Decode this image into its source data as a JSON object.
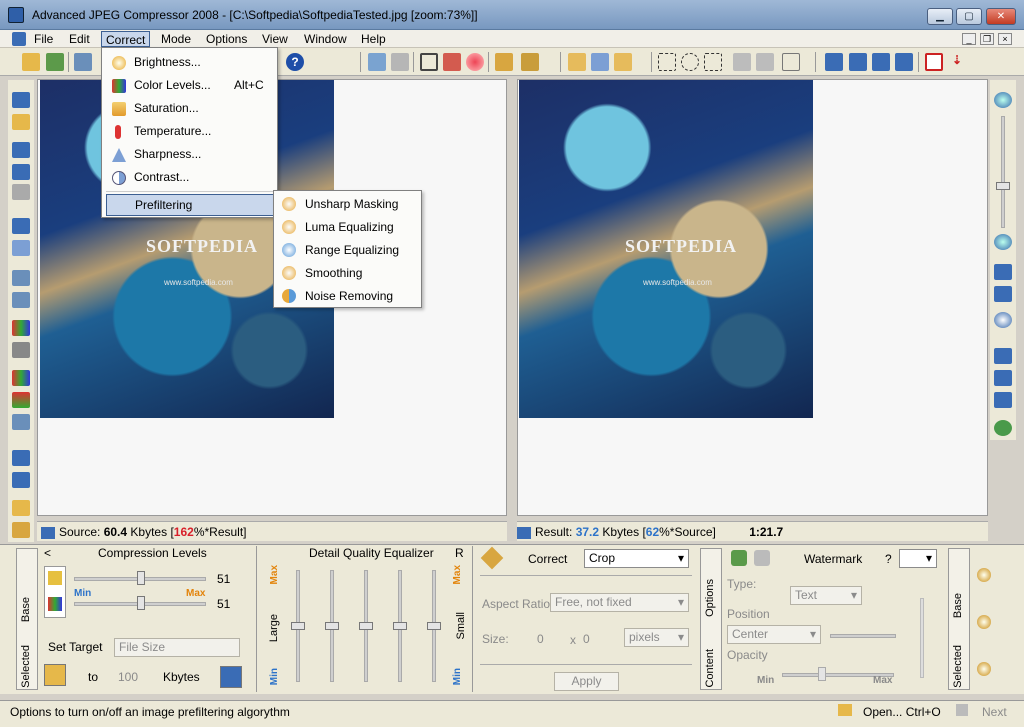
{
  "window": {
    "title": "Advanced JPEG Compressor 2008 - [C:\\Softpedia\\SoftpediaTested.jpg  [zoom:73%]]"
  },
  "menu": {
    "items": [
      "File",
      "Edit",
      "Correct",
      "Mode",
      "Options",
      "View",
      "Window",
      "Help"
    ]
  },
  "correct_menu": {
    "items": [
      {
        "label": "Brightness...",
        "shortcut": ""
      },
      {
        "label": "Color Levels...",
        "shortcut": "Alt+C"
      },
      {
        "label": "Saturation...",
        "shortcut": ""
      },
      {
        "label": "Temperature...",
        "shortcut": ""
      },
      {
        "label": "Sharpness...",
        "shortcut": ""
      },
      {
        "label": "Contrast...",
        "shortcut": ""
      },
      {
        "label": "Prefiltering",
        "shortcut": ""
      }
    ]
  },
  "prefilter_submenu": {
    "items": [
      "Unsharp Masking",
      "Luma Equalizing",
      "Range Equalizing",
      "Smoothing",
      "Noise Removing"
    ]
  },
  "image": {
    "logo": "SOFTPEDIA",
    "url": "www.softpedia.com"
  },
  "source_status": {
    "prefix": "Source:",
    "size": "60.4",
    "unit": "Kbytes",
    "pct_open": "[",
    "pct": "162",
    "pct_suffix": "%*Result]"
  },
  "result_status": {
    "prefix": "Result:",
    "size": "37.2",
    "unit": "Kbytes",
    "pct_open": "[",
    "pct": "62",
    "pct_suffix": "%*Source]",
    "ratio": "1:21.7"
  },
  "compression": {
    "title": "Compression Levels",
    "slider1_value": "51",
    "slider2_value": "51",
    "min_label": "Min",
    "max_label": "Max",
    "set_target_label": "Set Target",
    "target_type": "File Size",
    "to_label": "to",
    "target_value": "100",
    "unit": "Kbytes",
    "level1": 0.51,
    "level2": 0.51
  },
  "equalizer": {
    "title": "Detail Quality Equalizer",
    "r_label": "R",
    "max_label": "Max",
    "min_label": "Min",
    "large_label": "Large",
    "small_label": "Small",
    "levels": [
      0.5,
      0.5,
      0.5,
      0.5,
      0.5
    ]
  },
  "correct_panel": {
    "label": "Correct",
    "mode": "Crop",
    "aspect_label": "Aspect Ratio:",
    "aspect_value": "Free, not fixed",
    "size_label": "Size:",
    "width": "0",
    "x": "x",
    "height": "0",
    "unit": "pixels",
    "apply_label": "Apply"
  },
  "side_tabs": {
    "base": "Base",
    "selected": "Selected",
    "options": "Options",
    "content": "Content"
  },
  "watermark": {
    "title": "Watermark",
    "help": "?",
    "type_label": "Type:",
    "type_value": "Text",
    "position_label": "Position",
    "position_value": "Center",
    "opacity_label": "Opacity",
    "min_label": "Min",
    "max_label": "Max"
  },
  "status": {
    "text": "Options to turn on/off an image prefiltering algorythm",
    "open_label": "Open...  Ctrl+O",
    "next_label": "Next"
  },
  "colors": {
    "accent": "#2d73c9",
    "max_orange": "#e3840b",
    "source_red": "#d8202a",
    "title_bg": "#7898c0"
  }
}
